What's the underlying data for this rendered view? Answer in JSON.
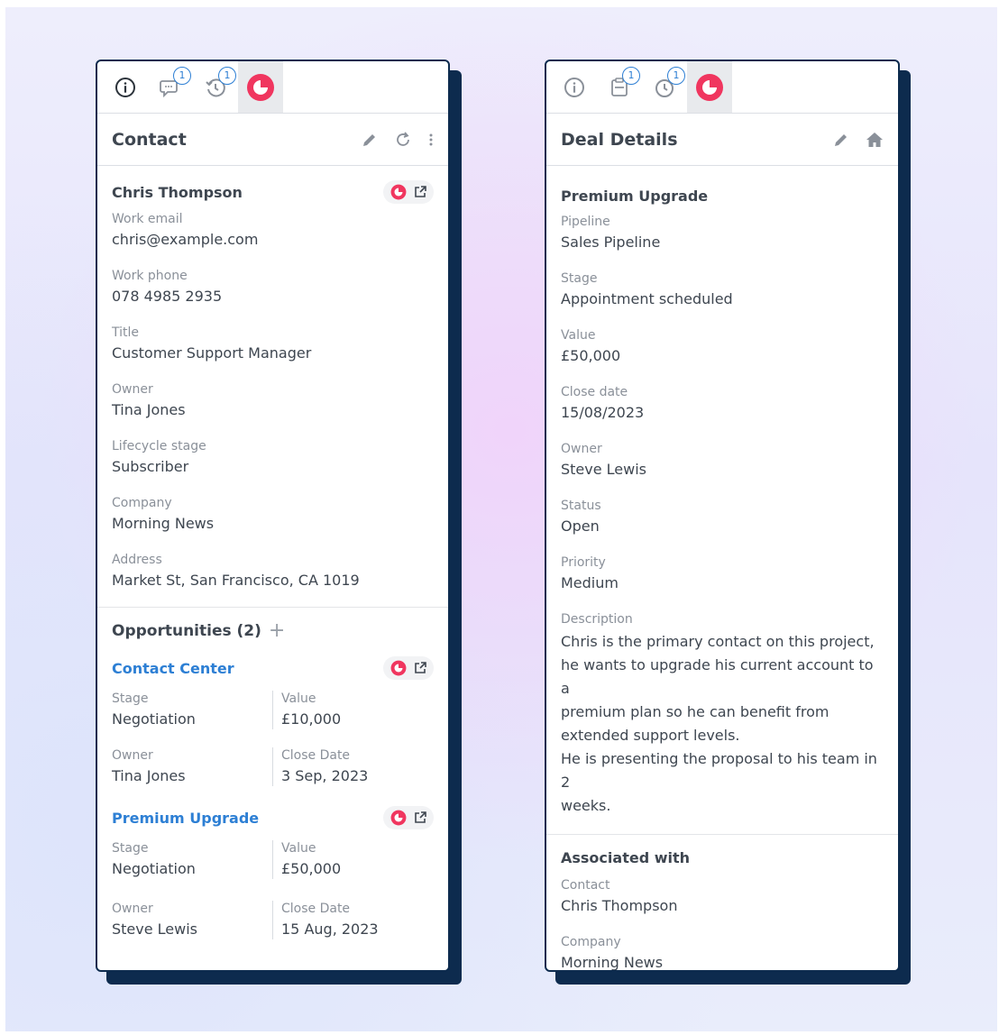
{
  "contact_panel": {
    "tabs": [
      {
        "icon": "info-icon"
      },
      {
        "icon": "chat-icon",
        "badge": "1"
      },
      {
        "icon": "history-icon",
        "badge": "1"
      },
      {
        "icon": "brand-logo-icon",
        "active": true
      }
    ],
    "title": "Contact",
    "contact": {
      "name": "Chris Thompson",
      "fields": [
        {
          "label": "Work email",
          "value": "chris@example.com"
        },
        {
          "label": "Work phone",
          "value": "078 4985 2935"
        },
        {
          "label": "Title",
          "value": "Customer Support Manager"
        },
        {
          "label": "Owner",
          "value": "Tina Jones"
        },
        {
          "label": "Lifecycle stage",
          "value": "Subscriber"
        },
        {
          "label": "Company",
          "value": "Morning News"
        },
        {
          "label": "Address",
          "value": "Market St, San Francisco, CA 1019"
        }
      ]
    },
    "opportunities": {
      "title": "Opportunities (2)",
      "add_label": "+",
      "items": [
        {
          "name": "Contact Center",
          "stage_label": "Stage",
          "stage": "Negotiation",
          "value_label": "Value",
          "value": "£10,000",
          "owner_label": "Owner",
          "owner": "Tina Jones",
          "close_label": "Close Date",
          "close": "3 Sep, 2023"
        },
        {
          "name": "Premium Upgrade",
          "stage_label": "Stage",
          "stage": "Negotiation",
          "value_label": "Value",
          "value": "£50,000",
          "owner_label": "Owner",
          "owner": "Steve Lewis",
          "close_label": "Close Date",
          "close": "15 Aug, 2023"
        }
      ]
    }
  },
  "deal_panel": {
    "tabs": [
      {
        "icon": "info-icon"
      },
      {
        "icon": "clipboard-icon",
        "badge": "1"
      },
      {
        "icon": "clock-icon",
        "badge": "1"
      },
      {
        "icon": "brand-logo-icon",
        "active": true
      }
    ],
    "title": "Deal Details",
    "deal_name": "Premium Upgrade",
    "fields": [
      {
        "label": "Pipeline",
        "value": "Sales Pipeline"
      },
      {
        "label": "Stage",
        "value": "Appointment scheduled"
      },
      {
        "label": "Value",
        "value": "£50,000"
      },
      {
        "label": "Close date",
        "value": "15/08/2023"
      },
      {
        "label": "Owner",
        "value": "Steve Lewis"
      },
      {
        "label": "Status",
        "value": "Open"
      },
      {
        "label": "Priority",
        "value": "Medium"
      }
    ],
    "description_label": "Description",
    "description": "Chris is the primary contact on this project,\nhe wants to upgrade his current account to a\npremium plan so he can benefit from\nextended support levels.\nHe is presenting the proposal to his team in 2\nweeks.",
    "associated": {
      "title": "Associated with",
      "contact_label": "Contact",
      "contact": "Chris Thompson",
      "company_label": "Company",
      "company": "Morning News"
    }
  },
  "colors": {
    "navy": "#0d2b4e",
    "brand": "#f0365f",
    "link": "#2d7fd4",
    "text": "#3e4650",
    "muted": "#8a9099"
  }
}
